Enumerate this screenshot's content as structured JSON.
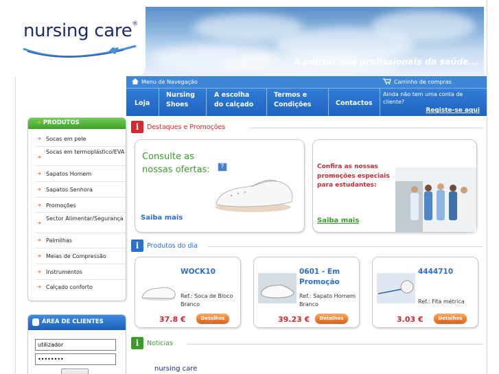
{
  "brand": {
    "name": "nursing care",
    "registered": "®",
    "tagline": "A pensar nos profissionais da saúde..."
  },
  "navbar": {
    "menu_title": "Menu de Navegação",
    "cart_title": "Carrinho de compras",
    "items": [
      {
        "label": "Loja"
      },
      {
        "label": "Nursing Shoes"
      },
      {
        "label": "A escolha do calçado"
      },
      {
        "label": "Termos e Condições"
      },
      {
        "label": "Contactos"
      }
    ],
    "account_text": "Ainda não tem uma conta de cliente?",
    "register_link": "Registe-se aqui"
  },
  "sidebar": {
    "title": "PRODUTOS",
    "items": [
      {
        "label": "Socas em pele"
      },
      {
        "label": "Socas em termoplástico/EVA"
      },
      {
        "label": "Sapatos Homem"
      },
      {
        "label": "Sapatos Senhora"
      },
      {
        "label": "Promoções"
      },
      {
        "label": "Sector Alimentar/Segurança"
      },
      {
        "label": "Palmilhas"
      },
      {
        "label": "Meias de Compressão"
      },
      {
        "label": "Instrumentos"
      },
      {
        "label": "Calçado conforto"
      }
    ]
  },
  "client_area": {
    "title": "ÁREA DE CLIENTES",
    "username_value": "utilizador",
    "password_value": "••••••••"
  },
  "highlights": {
    "title": "Destaques e Promoções",
    "promo1": {
      "title": "Consulte as nossas ofertas:",
      "help_icon": "?",
      "link": "Saiba mais"
    },
    "promo2": {
      "title": "Confira as nossas promoções especiais para estudantes:",
      "link": "Saiba mais"
    }
  },
  "products_of_day": {
    "title": "Produtos do dia",
    "products": [
      {
        "name": "WOCK10",
        "ref": "Ref.: Soca de Bloco Branco",
        "price": "37.8 €",
        "button": "Detalhes"
      },
      {
        "name": "0601 - Em Promoção",
        "ref": "Ref.: Sapato Homem Branco",
        "price": "39.23 €",
        "button": "Detalhes"
      },
      {
        "name": "4444710",
        "ref": "Ref.: Fita métrica",
        "price": "3.03 €",
        "button": "Detalhes"
      }
    ]
  },
  "news": {
    "title": "Noticias",
    "logo_text": "nursing care"
  },
  "colors": {
    "nav_blue": "#1e63c1",
    "green": "#3b9c2b",
    "red": "#d7282f",
    "link_blue": "#2a6ed0",
    "orange": "#e0621b"
  }
}
